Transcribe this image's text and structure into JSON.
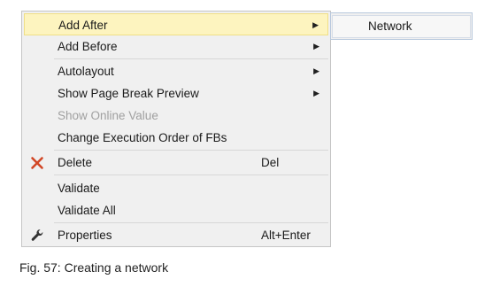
{
  "menu": {
    "items": [
      {
        "label": "Add After",
        "arrow": "▶"
      },
      {
        "label": "Add Before",
        "arrow": "▶"
      },
      {
        "label": "Autolayout",
        "arrow": "▶"
      },
      {
        "label": "Show Page Break Preview",
        "arrow": "▶"
      },
      {
        "label": "Show Online Value"
      },
      {
        "label": "Change Execution Order of FBs"
      },
      {
        "label": "Delete",
        "shortcut": "Del",
        "icon": "delete-x-icon"
      },
      {
        "label": "Validate"
      },
      {
        "label": "Validate All"
      },
      {
        "label": "Properties",
        "shortcut": "Alt+Enter",
        "icon": "wrench-icon"
      }
    ]
  },
  "submenu": {
    "items": [
      {
        "label": "Network"
      }
    ]
  },
  "caption": "Fig. 57: Creating a network",
  "colors": {
    "highlight": "#fdf4bf",
    "delete_icon": "#d24726",
    "disabled_text": "#a0a0a0"
  }
}
